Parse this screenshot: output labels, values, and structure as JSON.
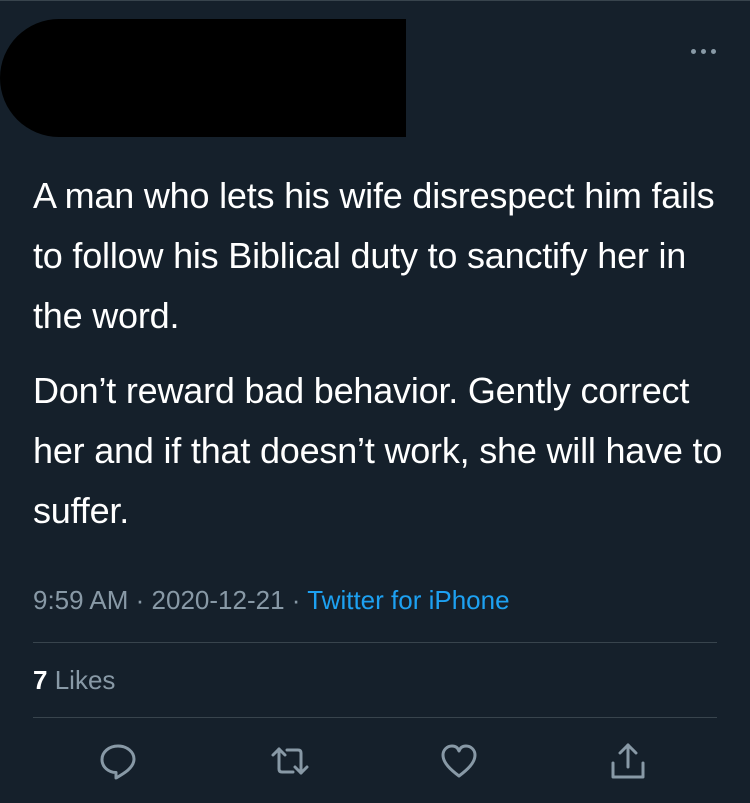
{
  "tweet": {
    "paragraphs": [
      "A man who lets his wife disrespect him fails to follow his Biblical duty to sanctify her in the word.",
      "Don’t reward bad behavior. Gently correct her and if that doesn’t work, she will have to suffer."
    ],
    "time": "9:59 AM",
    "separator": "·",
    "date": "2020-12-21",
    "source": "Twitter for iPhone",
    "likes_count": "7",
    "likes_label": "Likes"
  },
  "icons": {
    "more": "more-dots-icon",
    "reply": "reply-icon",
    "retweet": "retweet-icon",
    "like": "heart-icon",
    "share": "share-icon"
  },
  "colors": {
    "background": "#15202b",
    "text": "#ffffff",
    "muted": "#8899a6",
    "link": "#1da1f2",
    "divider": "#38444d"
  }
}
